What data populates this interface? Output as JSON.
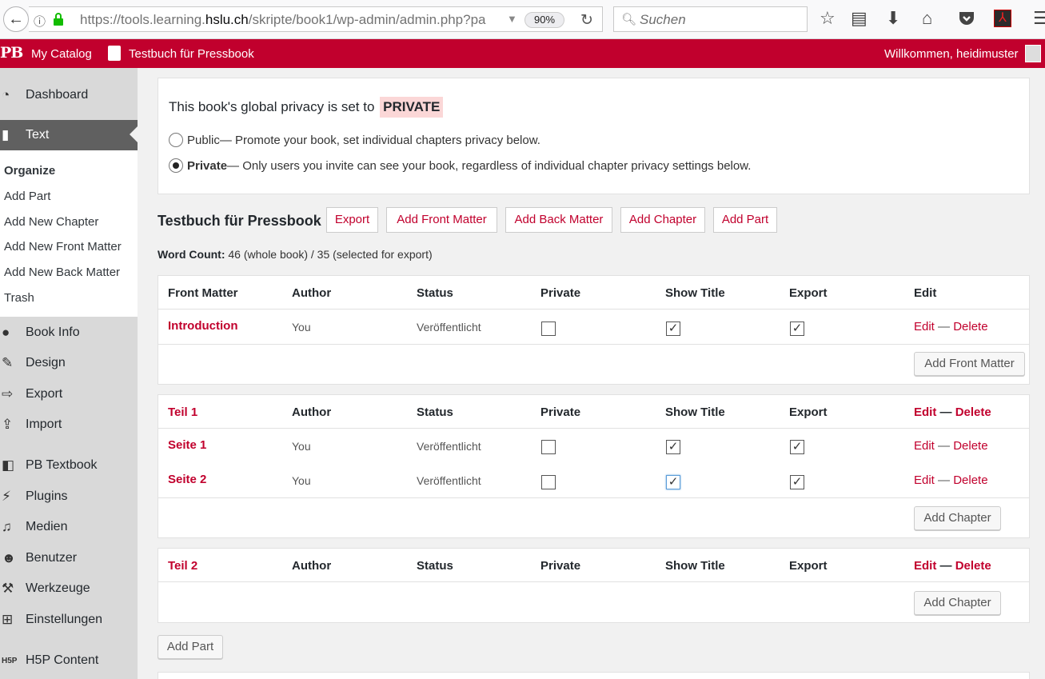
{
  "browser": {
    "url_prefix": "https://tools.learning.",
    "url_domain": "hslu.ch",
    "url_suffix": "/skripte/book1/wp-admin/admin.php?pa",
    "zoom": "90%",
    "search_placeholder": "Suchen"
  },
  "admin_bar": {
    "logo": "PB",
    "catalog": "My Catalog",
    "book": "Testbuch für Pressbook",
    "welcome": "Willkommen, heidimuster"
  },
  "sidebar": {
    "dashboard": "Dashboard",
    "text": "Text",
    "submenu": [
      "Organize",
      "Add Part",
      "Add New Chapter",
      "Add New Front Matter",
      "Add New Back Matter",
      "Trash"
    ],
    "book_info": "Book Info",
    "design": "Design",
    "export": "Export",
    "import": "Import",
    "pb_textbook": "PB Textbook",
    "plugins": "Plugins",
    "medien": "Medien",
    "benutzer": "Benutzer",
    "werkzeuge": "Werkzeuge",
    "einstellungen": "Einstellungen",
    "h5p": "H5P Content"
  },
  "privacy": {
    "intro": "This book's global privacy is set to",
    "badge": "PRIVATE",
    "public_label": "Public",
    "public_desc": " — Promote your book, set individual chapters privacy below.",
    "private_label": "Private",
    "private_desc": " — Only users you invite can see your book, regardless of individual chapter privacy settings below.",
    "selected": "private"
  },
  "book": {
    "title": "Testbuch für Pressbook",
    "buttons": [
      "Export",
      "Add Front Matter",
      "Add Back Matter",
      "Add Chapter",
      "Add Part"
    ],
    "word_count_label": "Word Count:",
    "word_count_value": "46 (whole book) / 35 (selected for export)"
  },
  "columns": {
    "author": "Author",
    "status": "Status",
    "private": "Private",
    "show_title": "Show Title",
    "export": "Export",
    "edit": "Edit"
  },
  "links": {
    "edit": "Edit",
    "dash": " — ",
    "delete": "Delete"
  },
  "front_matter": {
    "heading": "Front Matter",
    "rows": [
      {
        "title": "Introduction",
        "author": "You",
        "status": "Veröffentlicht",
        "private": false,
        "show_title": true,
        "export": true
      }
    ],
    "add_button": "Add Front Matter"
  },
  "parts": [
    {
      "heading": "Teil 1",
      "rows": [
        {
          "title": "Seite 1",
          "author": "You",
          "status": "Veröffentlicht",
          "private": false,
          "show_title": true,
          "export": true
        },
        {
          "title": "Seite 2",
          "author": "You",
          "status": "Veröffentlicht",
          "private": false,
          "show_title": true,
          "export": true
        }
      ],
      "add_button": "Add Chapter"
    },
    {
      "heading": "Teil 2",
      "rows": [],
      "add_button": "Add Chapter"
    }
  ],
  "add_part_button": "Add Part",
  "colors": {
    "brand": "#c1002d",
    "sidebar": "#d9d9d9",
    "active_menu": "#606060",
    "badge_bg": "#fbd7d7"
  }
}
